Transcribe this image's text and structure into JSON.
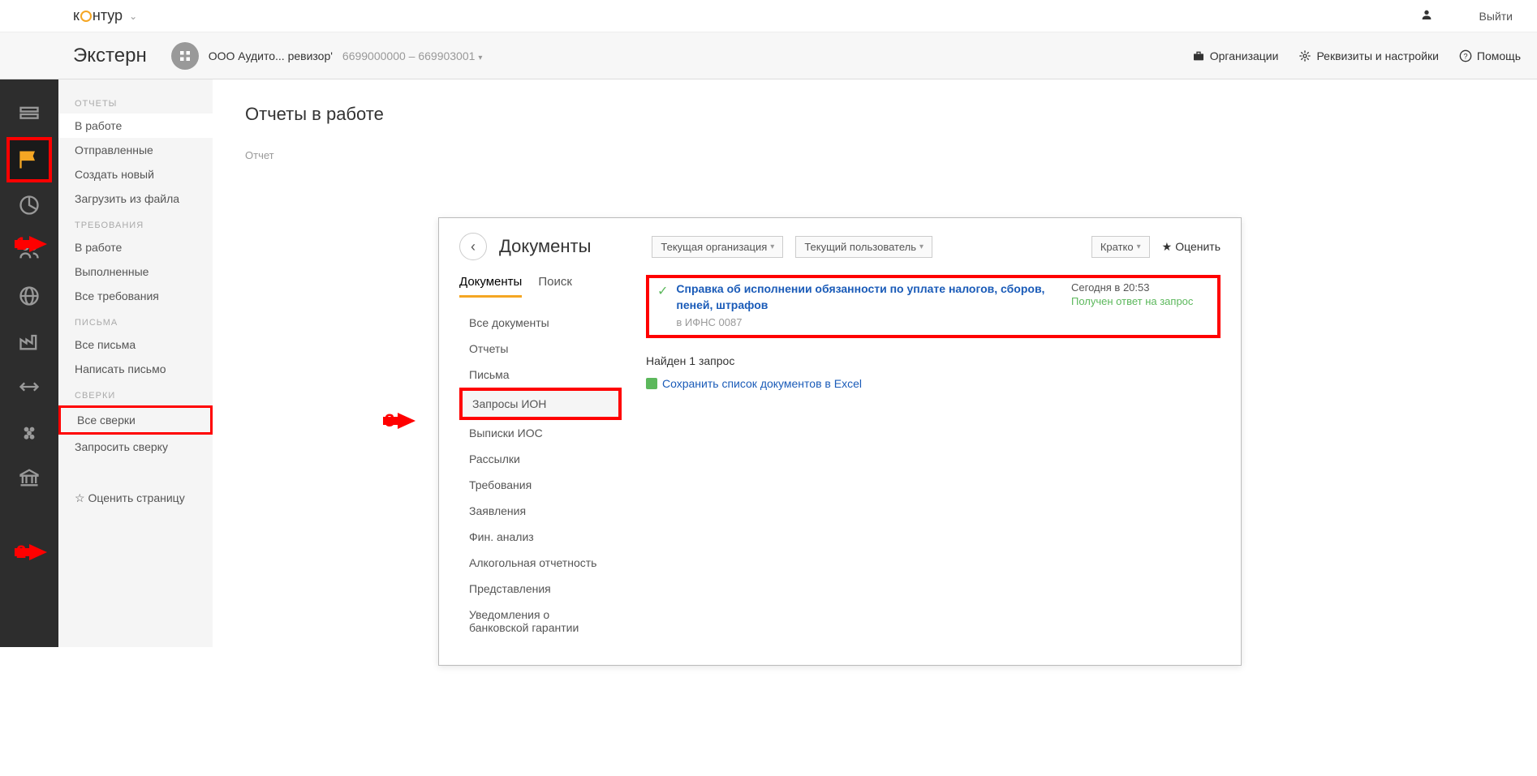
{
  "top": {
    "logo_part1": "к",
    "logo_part2": "нтур",
    "logout": "Выйти"
  },
  "header": {
    "app_title": "Экстерн",
    "org_name": "ООО Аудито... ревизор'",
    "org_code": "6699000000 – 669903001",
    "links": {
      "orgs": "Организации",
      "settings": "Реквизиты и настройки",
      "help": "Помощь"
    }
  },
  "sidebar": {
    "sections": {
      "reports": "ОТЧЕТЫ",
      "requirements": "ТРЕБОВАНИЯ",
      "letters": "ПИСЬМА",
      "reconciliations": "СВЕРКИ"
    },
    "items": {
      "in_work": "В работе",
      "sent": "Отправленные",
      "create_new": "Создать новый",
      "upload_file": "Загрузить из файла",
      "req_in_work": "В работе",
      "completed": "Выполненные",
      "all_reqs": "Все требования",
      "all_letters": "Все письма",
      "write_letter": "Написать письмо",
      "all_recon": "Все сверки",
      "request_recon": "Запросить сверку"
    },
    "rate_page": "Оценить страницу"
  },
  "content": {
    "title": "Отчеты в работе",
    "label": "Отчет"
  },
  "overlay": {
    "title": "Документы",
    "filters": {
      "current_org": "Текущая организация",
      "current_user": "Текущий пользователь",
      "brief": "Кратко"
    },
    "rate": "Оценить",
    "tabs": {
      "documents": "Документы",
      "search": "Поиск"
    },
    "nav": {
      "all_docs": "Все документы",
      "reports": "Отчеты",
      "letters": "Письма",
      "ion_requests": "Запросы ИОН",
      "ios_extracts": "Выписки ИОС",
      "mailings": "Рассылки",
      "requirements": "Требования",
      "applications": "Заявления",
      "fin_analysis": "Фин. анализ",
      "alcohol": "Алкогольная отчетность",
      "representations": "Представления",
      "bank_guarantee": "Уведомления о банковской гарантии"
    },
    "result": {
      "link": "Справка об исполнении обязанности по уплате налогов, сборов, пеней, штрафов",
      "sub": "в ИФНС 0087",
      "time": "Сегодня в 20:53",
      "status": "Получен ответ на запрос"
    },
    "found": "Найден 1 запрос",
    "excel_link": "Сохранить список документов в Excel"
  },
  "annotations": {
    "a1": "1",
    "a2": "2",
    "a3": "3"
  }
}
